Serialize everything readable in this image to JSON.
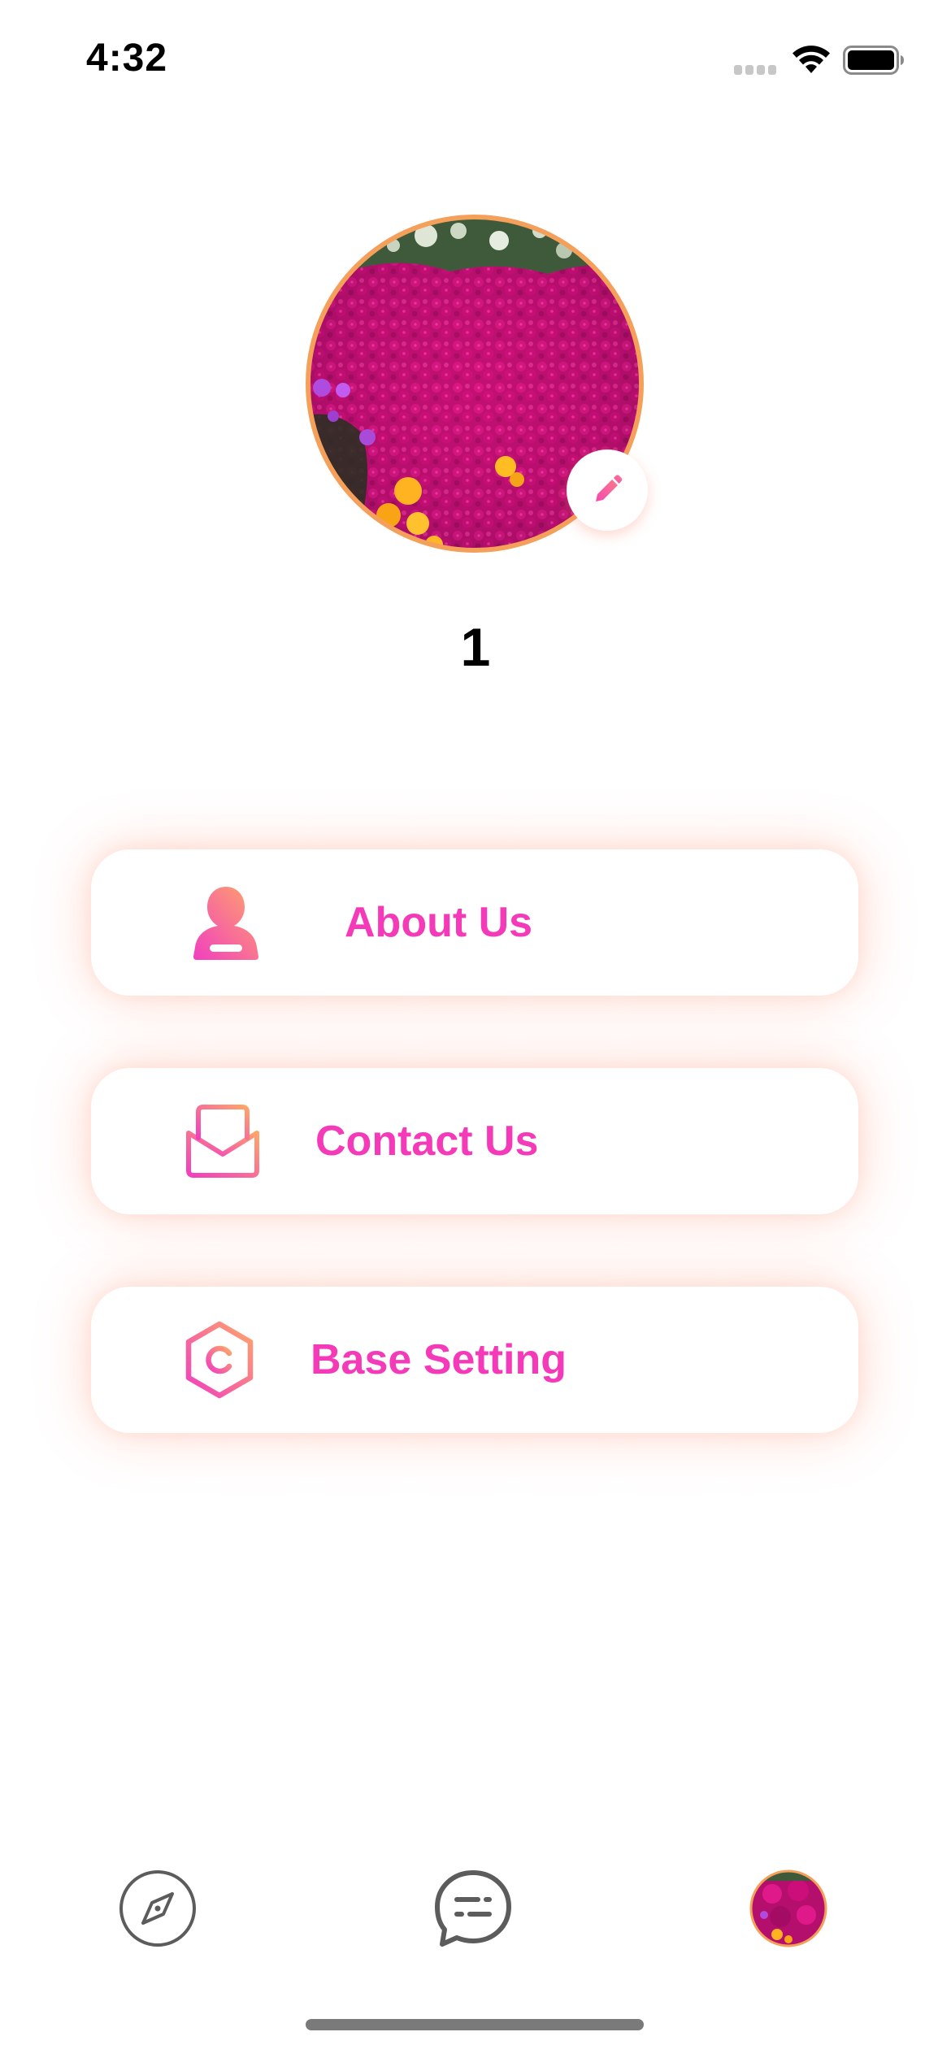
{
  "status_bar": {
    "time": "4:32",
    "icons": [
      "cellular-signal-icon",
      "wifi-icon",
      "battery-icon"
    ]
  },
  "profile": {
    "avatar": "flower-field-photo",
    "edit_icon": "pencil-icon",
    "name": "1"
  },
  "menu": [
    {
      "label": "About Us",
      "icon": "person-icon"
    },
    {
      "label": "Contact Us",
      "icon": "envelope-icon"
    },
    {
      "label": "Base Setting",
      "icon": "hexagon-settings-icon"
    }
  ],
  "tab_bar": {
    "tabs": [
      {
        "name": "discover",
        "icon": "compass-icon"
      },
      {
        "name": "messages",
        "icon": "chat-bubble-icon"
      },
      {
        "name": "profile",
        "icon": "avatar-thumbnail",
        "selected": true
      }
    ]
  },
  "colors": {
    "accent_pink": "#f43ab8",
    "accent_orange": "#ffa46b",
    "avatar_border": "#f5a05a",
    "tab_icon": "#5c5c5c"
  }
}
